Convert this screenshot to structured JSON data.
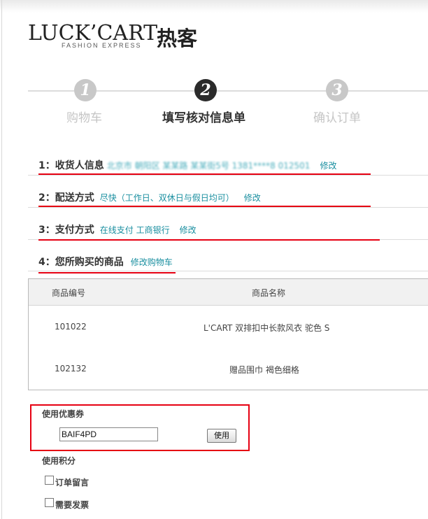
{
  "logo": {
    "brand": "LUCK’CART",
    "tagline": "FASHION EXPRESS",
    "cn_name": "热客"
  },
  "steps": [
    {
      "num": "1",
      "label": "购物车",
      "active": false
    },
    {
      "num": "2",
      "label": "填写核对信息单",
      "active": true
    },
    {
      "num": "3",
      "label": "确认订单",
      "active": false
    }
  ],
  "sections": {
    "receiver": {
      "title": "1：收货人信息",
      "value": "北京市 朝阳区 某某路 某某街5号 1381****8 012501",
      "edit": "修改"
    },
    "shipping": {
      "title": "2：配送方式",
      "value": "尽快（工作日、双休日与假日均可）",
      "edit": "修改"
    },
    "payment": {
      "title": "3：支付方式",
      "value": "在线支付 工商银行",
      "edit": "修改"
    },
    "products": {
      "title": "4：您所购买的商品",
      "edit": "修改购物车"
    }
  },
  "table": {
    "headers": [
      "商品编号",
      "商品名称"
    ],
    "rows": [
      {
        "id": "101022",
        "name": "L'CART 双排扣中长款风衣  驼色  S"
      },
      {
        "id": "102132",
        "name": "赠品围巾  褐色细格"
      }
    ]
  },
  "coupon": {
    "label": "使用优惠券",
    "value": "BAIF4PD",
    "button": "使用"
  },
  "points": {
    "label": "使用积分"
  },
  "options": [
    {
      "label": "订单留言",
      "checked": false
    },
    {
      "label": "需要发票",
      "checked": false
    }
  ],
  "colors": {
    "highlight_red": "#e60012",
    "link_teal": "#1a8fa0"
  }
}
